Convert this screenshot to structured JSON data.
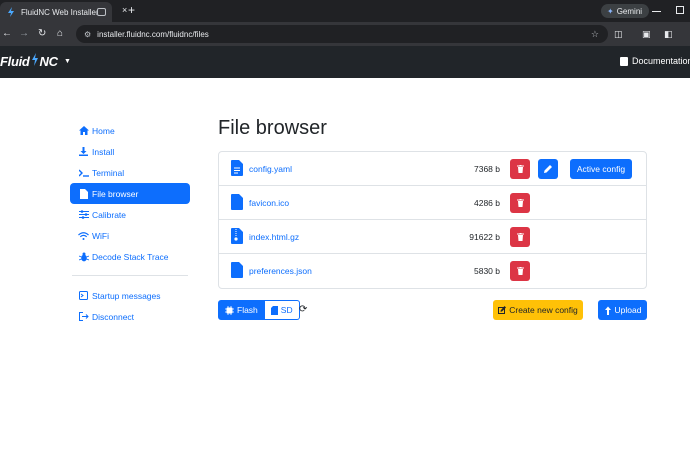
{
  "browser": {
    "tab_title": "FluidNC Web Installer",
    "new_tab": "+",
    "close_tab": "×",
    "url": "installer.fluidnc.com/fluidnc/files",
    "gemini_label": "Gemini"
  },
  "navbar": {
    "brand_left": "Fluid",
    "brand_right": "NC",
    "docs_label": "Documentation"
  },
  "sidebar": {
    "items": [
      {
        "label": "Home",
        "icon": "home-icon",
        "active": false
      },
      {
        "label": "Install",
        "icon": "download-icon",
        "active": false
      },
      {
        "label": "Terminal",
        "icon": "terminal-icon",
        "active": false
      },
      {
        "label": "File browser",
        "icon": "file-icon",
        "active": true
      },
      {
        "label": "Calibrate",
        "icon": "sliders-icon",
        "active": false
      },
      {
        "label": "WiFi",
        "icon": "wifi-icon",
        "active": false
      },
      {
        "label": "Decode Stack Trace",
        "icon": "bug-icon",
        "active": false
      }
    ],
    "secondary": [
      {
        "label": "Startup messages",
        "icon": "terminal-square-icon"
      },
      {
        "label": "Disconnect",
        "icon": "logout-icon"
      }
    ]
  },
  "main": {
    "title": "File browser",
    "files": [
      {
        "name": "config.yaml",
        "size": "7368 b",
        "icon": "file-text-icon"
      },
      {
        "name": "favicon.ico",
        "size": "4286 b",
        "icon": "file-icon"
      },
      {
        "name": "index.html.gz",
        "size": "91622 b",
        "icon": "file-zip-icon"
      },
      {
        "name": "preferences.json",
        "size": "5830 b",
        "icon": "file-icon"
      }
    ],
    "active_config_label": "Active config",
    "flash_label": "Flash",
    "sd_label": "SD",
    "create_label": "Create new config",
    "upload_label": "Upload"
  },
  "colors": {
    "primary": "#0d6efd",
    "danger": "#dc3545",
    "warning": "#ffc107",
    "navbar": "#212529"
  }
}
